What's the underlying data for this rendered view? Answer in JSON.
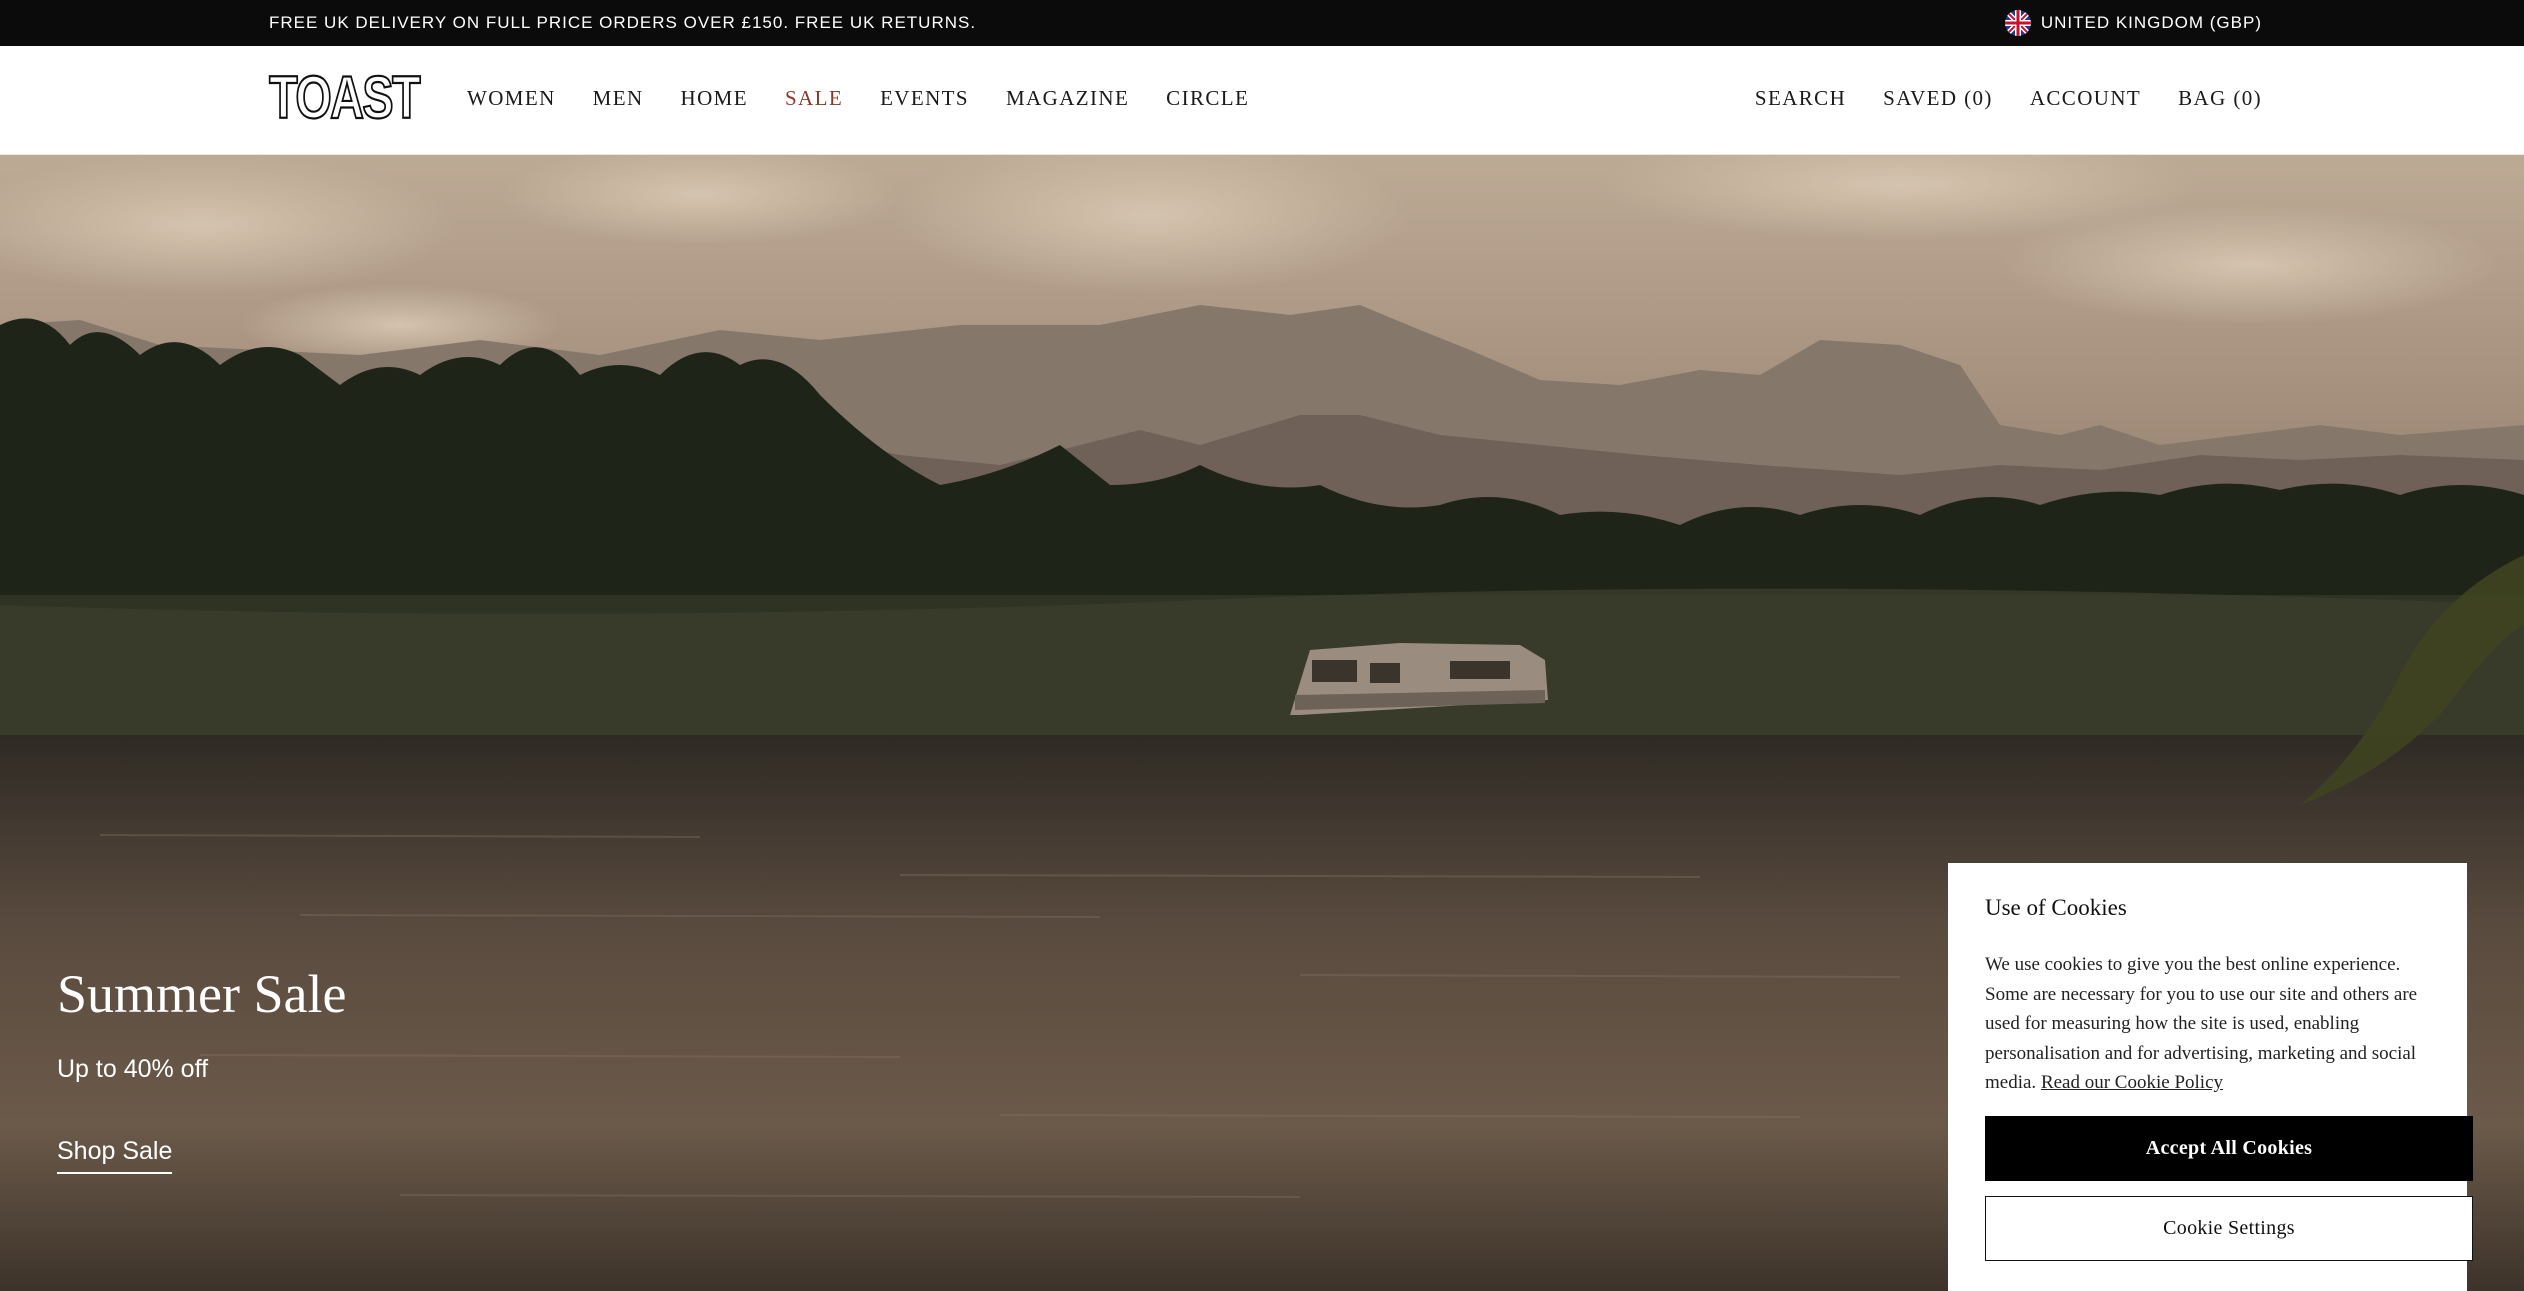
{
  "promo": {
    "text": "FREE UK DELIVERY ON FULL PRICE ORDERS OVER £150. FREE UK RETURNS.",
    "region": "UNITED KINGDOM (GBP)",
    "flag_icon": "uk-flag-icon"
  },
  "header": {
    "logo": "TOAST",
    "nav": [
      "WOMEN",
      "MEN",
      "HOME",
      "SALE",
      "EVENTS",
      "MAGAZINE",
      "CIRCLE"
    ],
    "utility": [
      "SEARCH",
      "SAVED (0)",
      "ACCOUNT",
      "BAG (0)"
    ]
  },
  "hero": {
    "title": "Summer Sale",
    "subtitle": "Up to 40% off",
    "cta": "Shop Sale"
  },
  "cookie": {
    "title": "Use of Cookies",
    "body": "We use cookies to give you the best online experience. Some are necessary for you to use our site and others are used for measuring how the site is used, enabling personalisation and for advertising, marketing and social media.",
    "link": "Read our Cookie Policy",
    "accept": "Accept All Cookies",
    "settings": "Cookie Settings"
  },
  "colors": {
    "sale_accent": "#8a3a2a",
    "promo_bar": "#0b0b0b",
    "button_dark": "#000000"
  }
}
